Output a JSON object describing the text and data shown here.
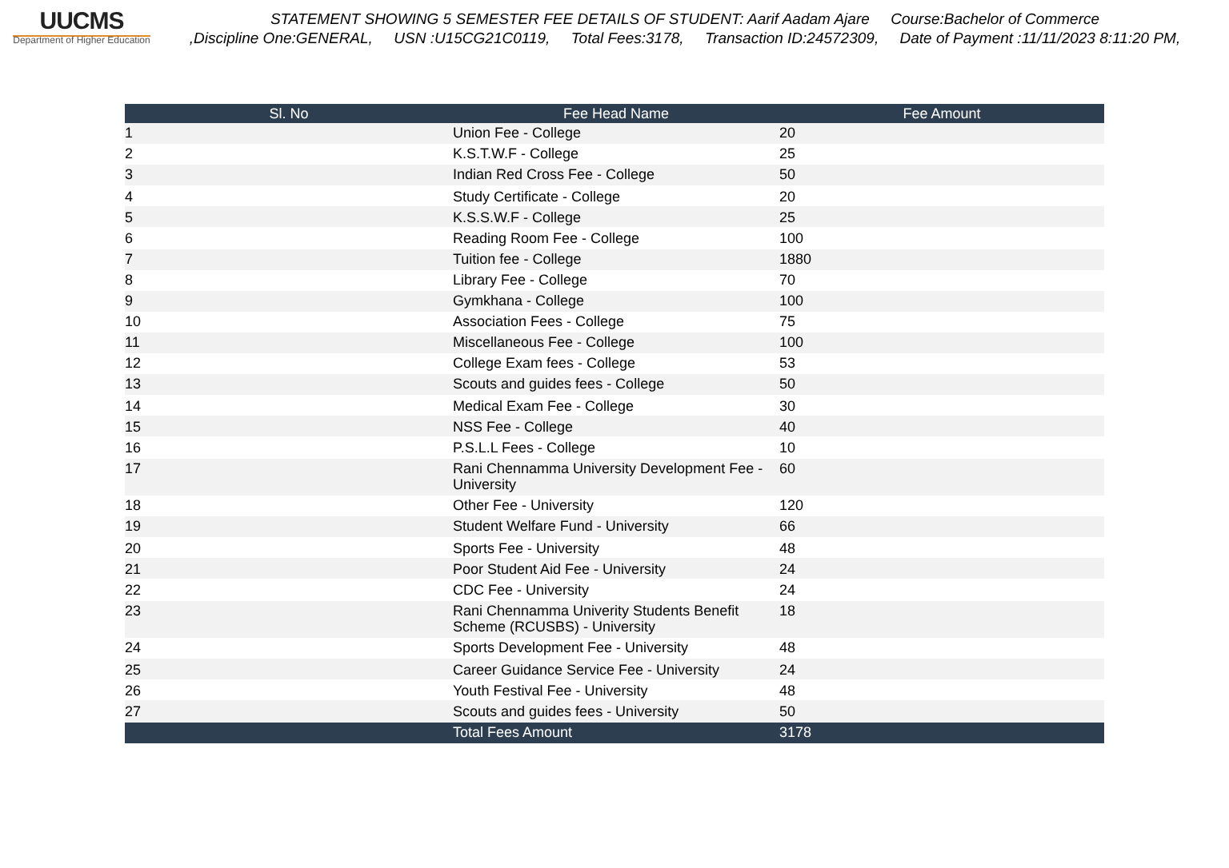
{
  "logo": {
    "text": "UUCMS",
    "subtitle": "Department of Higher Education"
  },
  "header": {
    "line_1": "STATEMENT SHOWING 5 SEMESTER FEE DETAILS OF STUDENT: Aarif Aadam Ajare     Course:Bachelor of Commerce",
    "line_2": ",Discipline One:GENERAL,     USN :U15CG21C0119,     Total Fees:3178,     Transaction ID:24572309,     Date of Payment :11/11/2023 8:11:20 PM,"
  },
  "table": {
    "columns": [
      "Sl. No",
      "Fee Head Name",
      "Fee Amount"
    ],
    "rows": [
      [
        "1",
        "Union Fee - College",
        "20"
      ],
      [
        "2",
        "K.S.T.W.F - College",
        "25"
      ],
      [
        "3",
        "Indian Red Cross Fee - College",
        "50"
      ],
      [
        "4",
        "Study Certificate - College",
        "20"
      ],
      [
        "5",
        "K.S.S.W.F - College",
        "25"
      ],
      [
        "6",
        "Reading Room Fee - College",
        "100"
      ],
      [
        "7",
        "Tuition fee - College",
        "1880"
      ],
      [
        "8",
        "Library Fee - College",
        "70"
      ],
      [
        "9",
        "Gymkhana - College",
        "100"
      ],
      [
        "10",
        "Association Fees - College",
        "75"
      ],
      [
        "11",
        "Miscellaneous Fee - College",
        "100"
      ],
      [
        "12",
        "College Exam fees - College",
        "53"
      ],
      [
        "13",
        "Scouts and guides fees - College",
        "50"
      ],
      [
        "14",
        "Medical Exam Fee - College",
        "30"
      ],
      [
        "15",
        "NSS Fee - College",
        "40"
      ],
      [
        "16",
        "P.S.L.L Fees - College",
        "10"
      ],
      [
        "17",
        "Rani Chennamma University Development Fee - University",
        "60"
      ],
      [
        "18",
        "Other Fee - University",
        "120"
      ],
      [
        "19",
        "Student Welfare Fund - University",
        "66"
      ],
      [
        "20",
        "Sports Fee - University",
        "48"
      ],
      [
        "21",
        "Poor Student Aid Fee - University",
        "24"
      ],
      [
        "22",
        "CDC Fee - University",
        "24"
      ],
      [
        "23",
        "Rani Chennamma Univerity Students Benefit Scheme (RCUSBS) - University",
        "18"
      ],
      [
        "24",
        "Sports Development Fee - University",
        "48"
      ],
      [
        "25",
        "Career Guidance Service Fee - University",
        "24"
      ],
      [
        "26",
        "Youth Festival Fee - University",
        "48"
      ],
      [
        "27",
        "Scouts and guides fees - University",
        "50"
      ]
    ],
    "total": {
      "label": "Total Fees Amount",
      "value": "3178"
    }
  }
}
